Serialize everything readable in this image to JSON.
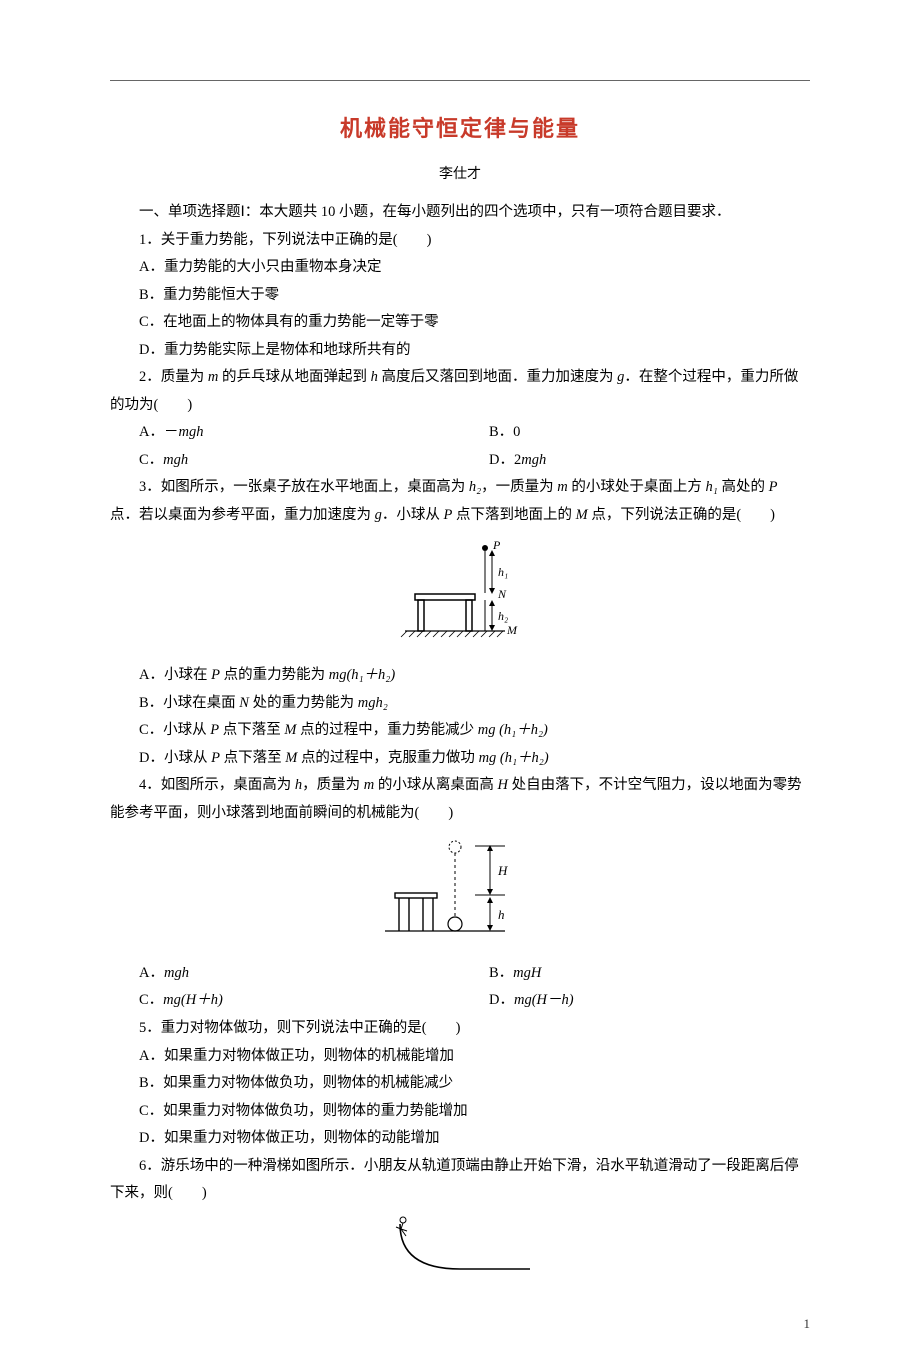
{
  "title": "机械能守恒定律与能量",
  "author": "李仕才",
  "section1_intro": "一、单项选择题Ⅰ：本大题共 10 小题，在每小题列出的四个选项中，只有一项符合题目要求．",
  "q1": {
    "stem": "1．关于重力势能，下列说法中正确的是(　　)",
    "A": "A．重力势能的大小只由重物本身决定",
    "B": "B．重力势能恒大于零",
    "C": "C．在地面上的物体具有的重力势能一定等于零",
    "D": "D．重力势能实际上是物体和地球所共有的"
  },
  "q2": {
    "stem_a": "2．质量为 ",
    "stem_b": " 的乒乓球从地面弹起到 ",
    "stem_c": " 高度后又落回到地面．重力加速度为 ",
    "stem_d": "．在整个过程中，重力所做的功为(　　)",
    "A_pre": "A．－",
    "B": "B．0",
    "C_pre": "C．",
    "D_pre": "D．2"
  },
  "q3": {
    "stem_a": "3．如图所示，一张桌子放在水平地面上，桌面高为 ",
    "stem_b": "，一质量为 ",
    "stem_c": " 的小球处于桌面上方 ",
    "stem_d": " 高处的 ",
    "stem_e": " 点．若以桌面为参考平面，重力加速度为 ",
    "stem_f": "．小球从 ",
    "stem_g": " 点下落到地面上的 ",
    "stem_h": " 点，下列说法正确的是(　　)",
    "A_a": "A．小球在 ",
    "A_b": " 点的重力势能为 ",
    "B_a": "B．小球在桌面 ",
    "B_b": " 处的重力势能为 ",
    "C_a": "C．小球从 ",
    "C_b": " 点下落至 ",
    "C_c": " 点的过程中，重力势能减少 ",
    "D_a": "D．小球从 ",
    "D_b": " 点下落至 ",
    "D_c": " 点的过程中，克服重力做功 "
  },
  "q4": {
    "stem_a": "4．如图所示，桌面高为 ",
    "stem_b": "，质量为 ",
    "stem_c": " 的小球从离桌面高 ",
    "stem_d": " 处自由落下，不计空气阻力，设以地面为零势能参考平面，则小球落到地面前瞬间的机械能为(　　)",
    "A_pre": "A．",
    "B_pre": "B．",
    "C_pre": "C．",
    "D_pre": "D．"
  },
  "q5": {
    "stem": "5．重力对物体做功，则下列说法中正确的是(　　)",
    "A": "A．如果重力对物体做正功，则物体的机械能增加",
    "B": "B．如果重力对物体做负功，则物体的机械能减少",
    "C": "C．如果重力对物体做负功，则物体的重力势能增加",
    "D": "D．如果重力对物体做正功，则物体的动能增加"
  },
  "q6": {
    "stem": "6．游乐场中的一种滑梯如图所示．小朋友从轨道顶端由静止开始下滑，沿水平轨道滑动了一段距离后停下来，则(　　)"
  },
  "sym": {
    "m": "m",
    "h": "h",
    "g": "g",
    "H": "H",
    "h1": "h₁",
    "h2": "h₂",
    "P": "P",
    "N": "N",
    "M": "M",
    "mgh": "mgh",
    "mgH": "mgH",
    "mg_h1h2": "mg(h₁＋h₂)",
    "mg_sp_h1h2": "mg (h₁＋h₂)",
    "mgh2": "mgh₂",
    "mg_Hplush": "mg(H＋h)",
    "mg_Hminush": "mg(H－h)"
  },
  "fig3": {
    "P": "P",
    "N": "N",
    "M": "M",
    "h1": "h₁",
    "h2": "h₂"
  },
  "fig4": {
    "H": "H",
    "h": "h"
  },
  "pagenum": "1"
}
